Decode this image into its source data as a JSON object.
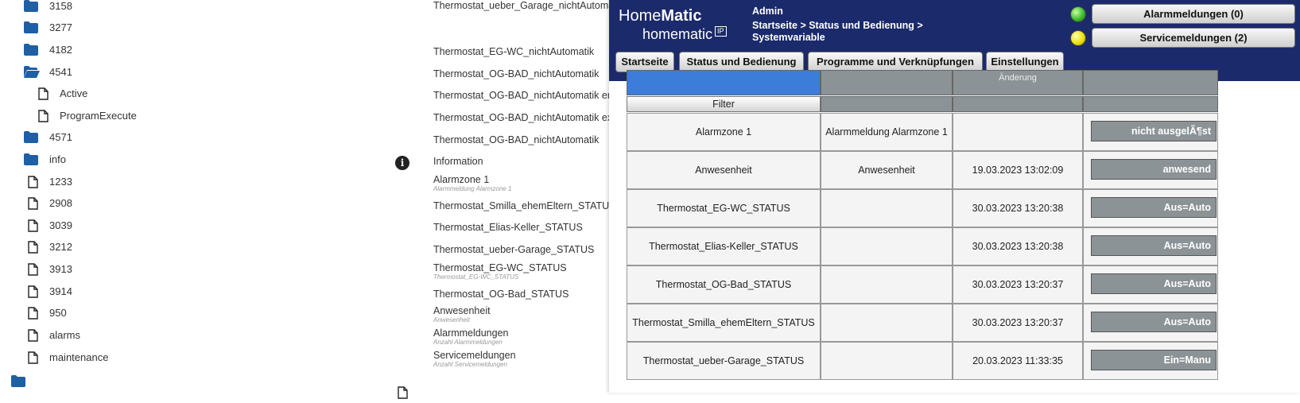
{
  "tree": {
    "items": [
      {
        "label": "3158",
        "type": "folder"
      },
      {
        "label": "3277",
        "type": "folder"
      },
      {
        "label": "4182",
        "type": "folder"
      },
      {
        "label": "4541",
        "type": "folder-open"
      },
      {
        "label": "Active",
        "type": "file-child"
      },
      {
        "label": "ProgramExecute",
        "type": "file-child"
      },
      {
        "label": "4571",
        "type": "folder"
      },
      {
        "label": "info",
        "type": "folder"
      },
      {
        "label": "1233",
        "type": "file"
      },
      {
        "label": "2908",
        "type": "file"
      },
      {
        "label": "3039",
        "type": "file"
      },
      {
        "label": "3212",
        "type": "file"
      },
      {
        "label": "3913",
        "type": "file"
      },
      {
        "label": "3914",
        "type": "file"
      },
      {
        "label": "950",
        "type": "file"
      },
      {
        "label": "alarms",
        "type": "file"
      },
      {
        "label": "maintenance",
        "type": "file"
      }
    ]
  },
  "desc": {
    "items": [
      {
        "title": "Thermostat_ueber_Garage_nichtAutomatik",
        "sub": ""
      },
      {
        "title": "Thermostat_EG-WC_nichtAutomatik",
        "sub": ""
      },
      {
        "title": "Thermostat_OG-BAD_nichtAutomatik",
        "sub": ""
      },
      {
        "title": "Thermostat_OG-BAD_nichtAutomatik en",
        "sub": ""
      },
      {
        "title": "Thermostat_OG-BAD_nichtAutomatik ex",
        "sub": ""
      },
      {
        "title": "Thermostat_OG-BAD_nichtAutomatik",
        "sub": ""
      },
      {
        "title": "Information",
        "sub": ""
      },
      {
        "title": "Alarmzone 1",
        "sub": "Alarmmeldung Alarmzone 1"
      },
      {
        "title": "Thermostat_Smilla_ehemEltern_STATUS",
        "sub": ""
      },
      {
        "title": "Thermostat_Elias-Keller_STATUS",
        "sub": ""
      },
      {
        "title": "Thermostat_ueber-Garage_STATUS",
        "sub": ""
      },
      {
        "title": "Thermostat_EG-WC_STATUS",
        "sub": "Thermostat_EG-WC_STATUS"
      },
      {
        "title": "Thermostat_OG-Bad_STATUS",
        "sub": ""
      },
      {
        "title": "Anwesenheit",
        "sub": "Anwesenheit"
      },
      {
        "title": "Alarmmeldungen",
        "sub": "Anzahl Alarmmeldungen"
      },
      {
        "title": "Servicemeldungen",
        "sub": "Anzahl Servicemeldungen"
      }
    ]
  },
  "homematic": {
    "logo_home": "Home",
    "logo_matic": "Matic",
    "logo_small": "homematic",
    "logo_ip": "IP",
    "user": "Admin",
    "breadcrumb": "Startseite > Status und Bedienung > Systemvariable",
    "alarm_button": "Alarmmeldungen (0)",
    "service_button": "Servicemeldungen (2)",
    "status_colors": {
      "alarm": "#35b82a",
      "service": "#e8e000"
    },
    "nav": [
      "Startseite",
      "Status und Bedienung",
      "Programme und Verknüpfungen",
      "Einstellungen"
    ],
    "table": {
      "header_partial": "Änderung",
      "filter_label": "Filter",
      "rows": [
        {
          "name": "Alarmzone 1",
          "desc": "Alarmmeldung Alarmzone 1",
          "time": "",
          "value": "nicht ausgelÃ¶st"
        },
        {
          "name": "Anwesenheit",
          "desc": "Anwesenheit",
          "time": "19.03.2023 13:02:09",
          "value": "anwesend"
        },
        {
          "name": "Thermostat_EG-WC_STATUS",
          "desc": "",
          "time": "30.03.2023 13:20:38",
          "value": "Aus=Auto"
        },
        {
          "name": "Thermostat_Elias-Keller_STATUS",
          "desc": "",
          "time": "30.03.2023 13:20:38",
          "value": "Aus=Auto"
        },
        {
          "name": "Thermostat_OG-Bad_STATUS",
          "desc": "",
          "time": "30.03.2023 13:20:37",
          "value": "Aus=Auto"
        },
        {
          "name": "Thermostat_Smilla_ehemEltern_STATUS",
          "desc": "",
          "time": "30.03.2023 13:20:37",
          "value": "Aus=Auto"
        },
        {
          "name": "Thermostat_ueber-Garage_STATUS",
          "desc": "",
          "time": "20.03.2023 11:33:35",
          "value": "Ein=Manu"
        }
      ]
    }
  }
}
